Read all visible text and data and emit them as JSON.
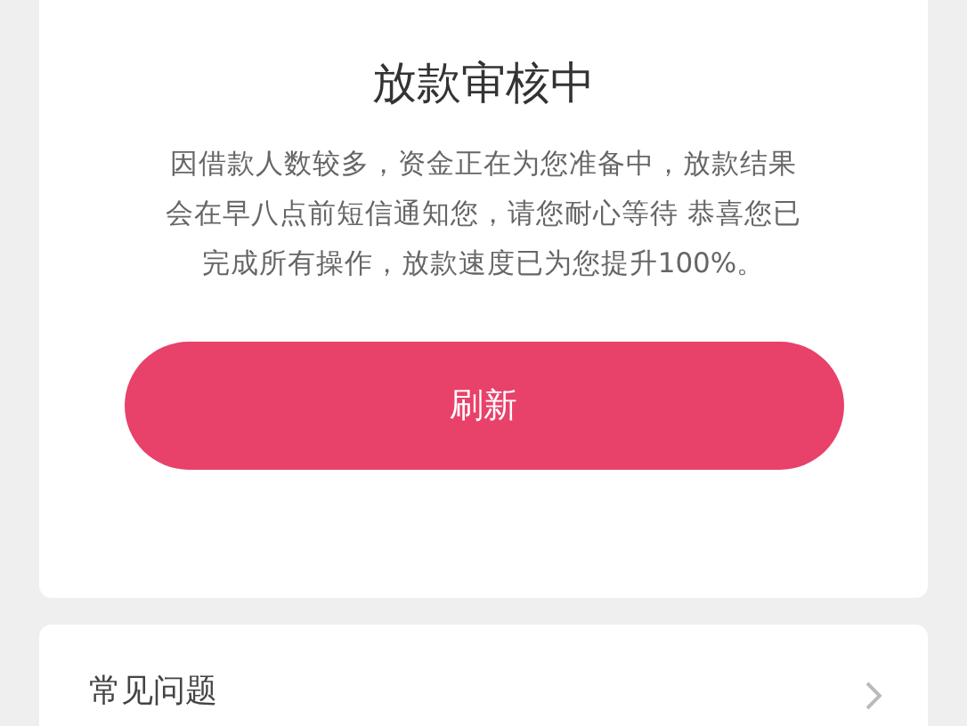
{
  "status_card": {
    "title": "放款审核中",
    "message_lines": [
      "因借款人数较多，资金正在为您准备中，放款结果",
      "会在早八点前短信通知您，请您耐心等待 恭喜您已",
      "完成所有操作，放款速度已为您提升100%。"
    ],
    "button": "刷新"
  },
  "faq_card": {
    "label": "常见问题"
  }
}
